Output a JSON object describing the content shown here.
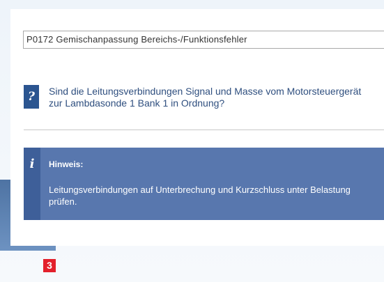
{
  "fault": {
    "code_text": "P0172 Gemischanpassung Bereichs-/Funktionsfehler"
  },
  "question": {
    "icon": "question-icon",
    "text": "Sind die Leitungsverbindungen Signal und Masse vom Motorsteuergerät zur Lambdasonde 1 Bank 1 in Ordnung?"
  },
  "note": {
    "icon": "info-icon",
    "title": "Hinweis:",
    "text": "Leitungsverbindungen auf Unterbrechung und Kurzschluss unter Belastung  prüfen."
  },
  "step": {
    "number": "3"
  },
  "colors": {
    "note_background": "#5877ae",
    "icon_background": "#2b5590",
    "question_text": "#2f4f7f",
    "step_badge": "#e3202b"
  }
}
